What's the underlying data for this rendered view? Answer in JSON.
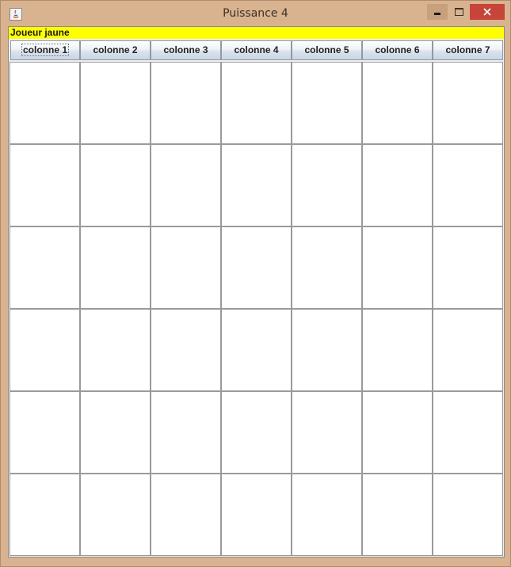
{
  "window": {
    "title": "Puissance 4",
    "app_icon": "java-icon",
    "controls": [
      "minimize",
      "maximize",
      "close"
    ]
  },
  "status": {
    "text": "Joueur jaune",
    "background": "#ffff00"
  },
  "columns": [
    {
      "label": "colonne 1"
    },
    {
      "label": "colonne 2"
    },
    {
      "label": "colonne 3"
    },
    {
      "label": "colonne 4"
    },
    {
      "label": "colonne 5"
    },
    {
      "label": "colonne 6"
    },
    {
      "label": "colonne 7"
    }
  ],
  "board": {
    "rows": 6,
    "cols": 7,
    "cells": [
      [
        "",
        "",
        "",
        "",
        "",
        "",
        ""
      ],
      [
        "",
        "",
        "",
        "",
        "",
        "",
        ""
      ],
      [
        "",
        "",
        "",
        "",
        "",
        "",
        ""
      ],
      [
        "",
        "",
        "",
        "",
        "",
        "",
        ""
      ],
      [
        "",
        "",
        "",
        "",
        "",
        "",
        ""
      ],
      [
        "",
        "",
        "",
        "",
        "",
        "",
        ""
      ]
    ]
  },
  "colors": {
    "frame": "#d9b38f",
    "close_button": "#c7443a",
    "cell_border": "#9a9a9a"
  }
}
